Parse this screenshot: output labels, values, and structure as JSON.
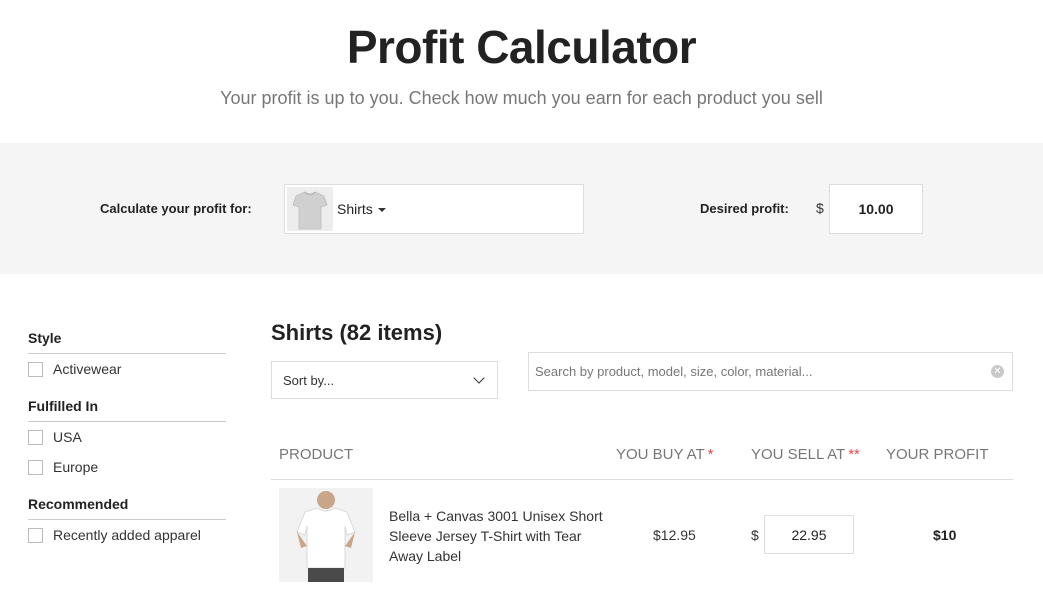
{
  "header": {
    "title": "Profit Calculator",
    "subtitle": "Your profit is up to you. Check how much you earn for each product you sell"
  },
  "calculator": {
    "label": "Calculate your profit for:",
    "product_selected": "Shirts",
    "product_thumbnail_icon": "tshirt-icon",
    "profit_label": "Desired profit:",
    "currency_symbol": "$",
    "profit_value": "10.00"
  },
  "filters": [
    {
      "title": "Style",
      "options": [
        "Activewear"
      ]
    },
    {
      "title": "Fulfilled In",
      "options": [
        "USA",
        "Europe"
      ]
    },
    {
      "title": "Recommended",
      "options": [
        "Recently added apparel"
      ]
    }
  ],
  "main": {
    "title": "Shirts (82 items)",
    "sort_placeholder": "Sort by...",
    "search_placeholder": "Search by product, model, size, color, material..."
  },
  "table": {
    "columns": {
      "product": "PRODUCT",
      "buy": "YOU BUY AT",
      "buy_marker": "*",
      "sell": "YOU SELL AT",
      "sell_marker": "**",
      "profit": "YOUR PROFIT"
    },
    "rows": [
      {
        "name": "Bella + Canvas 3001 Unisex Short Sleeve Jersey T-Shirt with Tear Away Label",
        "buy_price": "$12.95",
        "currency_symbol": "$",
        "sell_price": "22.95",
        "profit": "$10"
      }
    ]
  },
  "colors": {
    "band_bg": "#f5f5f5",
    "required_marker": "#e84a4a",
    "muted_text": "#777777"
  }
}
